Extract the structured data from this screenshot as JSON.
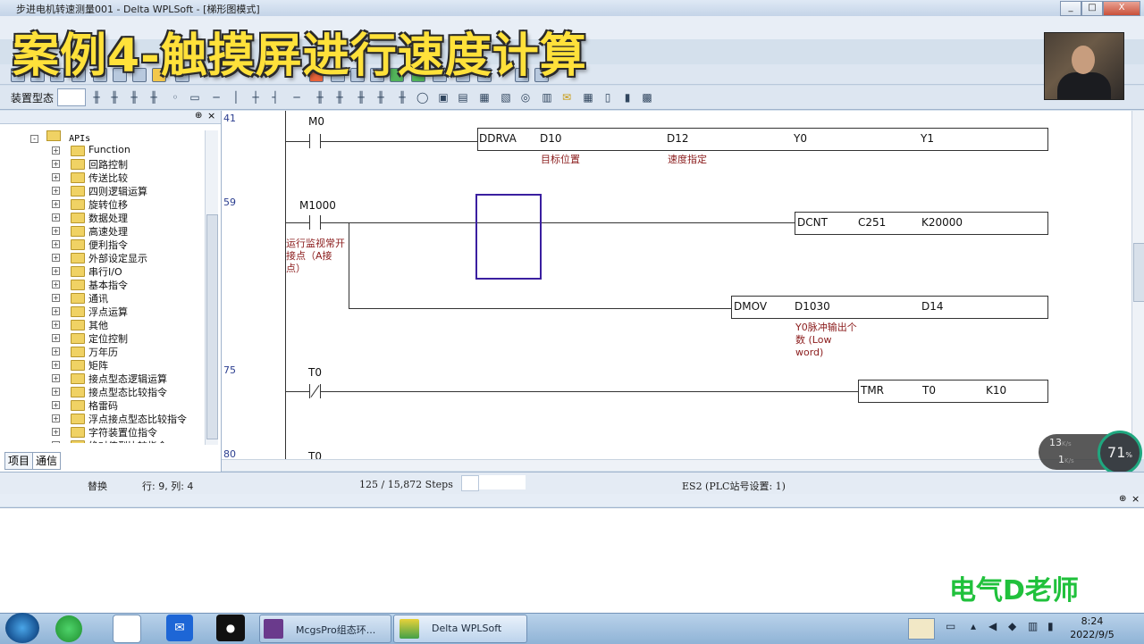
{
  "window": {
    "title": "步进电机转速测量001 - Delta WPLSoft - [梯形图模式]",
    "buttons": [
      "_",
      "□",
      "X"
    ]
  },
  "overlay": {
    "banner": "案例4-触摸屏进行速度计算",
    "watermark": "电气D老师"
  },
  "toolbar": {
    "device_label": "装置型态"
  },
  "tree": {
    "root": "APIs",
    "items": [
      "Function",
      "回路控制",
      "传送比较",
      "四则逻辑运算",
      "旋转位移",
      "数据处理",
      "高速处理",
      "便利指令",
      "外部设定显示",
      "串行I/O",
      "基本指令",
      "通讯",
      "浮点运算",
      "其他",
      "定位控制",
      "万年历",
      "矩阵",
      "接点型态逻辑运算",
      "接点型态比较指令",
      "格雷码",
      "浮点接点型态比较指令",
      "字符装置位指令",
      "绝对值型比较指令"
    ],
    "tabs": [
      "项目",
      "通信"
    ]
  },
  "ladder": {
    "rung1": {
      "num": "41",
      "contact": "M0",
      "instr": "DDRVA",
      "ops": [
        "D10",
        "D12",
        "Y0",
        "Y1"
      ],
      "cmts": [
        "目标位置",
        "速度指定"
      ]
    },
    "rung2": {
      "num": "59",
      "contact": "M1000",
      "contact_cmt": "运行监视常开接点（A接点）",
      "instr1": "DCNT",
      "ops1": [
        "C251",
        "K20000"
      ],
      "instr2": "DMOV",
      "ops2": [
        "D1030",
        "D14"
      ],
      "cmt2": "Y0脉冲输出个数 (Low word)"
    },
    "rung3": {
      "num": "75",
      "contact": "T0",
      "instr": "TMR",
      "ops": [
        "T0",
        "K10"
      ]
    },
    "rung4": {
      "num": "80",
      "contact": "T0"
    }
  },
  "status": {
    "mode": "替换",
    "position": "行: 9, 列: 4",
    "steps": "125 / 15,872 Steps",
    "plc": "ES2 (PLC站号设置: 1)"
  },
  "gauge": {
    "up": "13",
    "down": "1",
    "unit": "K/s",
    "percent": "71",
    "percent_unit": "%"
  },
  "taskbar": {
    "apps": [
      "McgsPro组态环...",
      "Delta WPLSoft"
    ],
    "time": "8:24",
    "date": "2022/9/5"
  }
}
